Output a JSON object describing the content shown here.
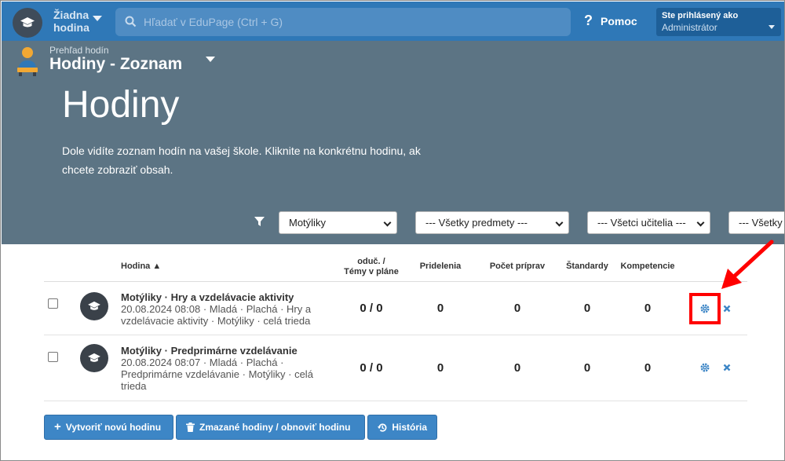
{
  "topbar": {
    "lesson_line1": "Žiadna",
    "lesson_line2": "hodina",
    "search_placeholder": "Hľadať v EduPage (Ctrl + G)",
    "help_label": "Pomoc",
    "user_line1": "Ste prihlásený ako",
    "user_line2": "Administrátor"
  },
  "hero": {
    "crumb_small": "Prehľad hodín",
    "crumb_title": "Hodiny - Zoznam",
    "title": "Hodiny",
    "description": "Dole vidíte zoznam hodín na vašej škole. Kliknite na konkrétnu hodinu, ak chcete zobraziť obsah."
  },
  "filters": {
    "class": "Motýliky",
    "subject": "--- Všetky predmety ---",
    "teacher": "--- Všetci učitelia ---",
    "fourth": "--- Všetky"
  },
  "table": {
    "headers": {
      "hodina": "Hodina ▲",
      "oduc_line1": "oduč. /",
      "oduc_line2": "Témy v pláne",
      "pridelenia": "Pridelenia",
      "pocet": "Počet príprav",
      "standardy": "Štandardy",
      "kompetencie": "Kompetencie"
    },
    "rows": [
      {
        "name": "Motýliky · Hry a vzdelávacie aktivity",
        "desc": "20.08.2024 08:08 · Mladá · Plachá · Hry a vzdelávacie aktivity · Motýliky · celá trieda",
        "oduc": "0 / 0",
        "pridelenia": "0",
        "pocet": "0",
        "standardy": "0",
        "kompetencie": "0"
      },
      {
        "name": "Motýliky · Predprimárne vzdelávanie",
        "desc": "20.08.2024 08:07 · Mladá · Plachá · Predprimárne vzdelávanie · Motýliky · celá trieda",
        "oduc": "0 / 0",
        "pridelenia": "0",
        "pocet": "0",
        "standardy": "0",
        "kompetencie": "0"
      }
    ]
  },
  "buttons": {
    "create": "Vytvoriť novú hodinu",
    "deleted": "Zmazané hodiny / obnoviť hodinu",
    "history": "História"
  },
  "colors": {
    "topbar": "#2f78b7",
    "hero": "#5c7484",
    "button": "#3d86c6",
    "highlight": "#ff0000"
  }
}
